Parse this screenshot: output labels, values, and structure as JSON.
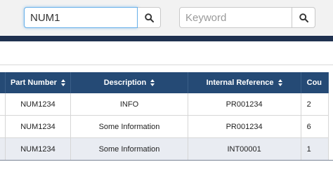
{
  "search": {
    "primary_value": "NUM1",
    "keyword_placeholder": "Keyword"
  },
  "table": {
    "headers": [
      "Part Number",
      "Description",
      "Internal Reference",
      "Cou"
    ],
    "rows": [
      [
        "NUM1234",
        "INFO",
        "PR001234",
        "2"
      ],
      [
        "NUM1234",
        "Some Information",
        "PR001234",
        "6"
      ],
      [
        "NUM1234",
        "Some Information",
        "INT00001",
        "1"
      ]
    ]
  },
  "icons": {
    "search": "search-icon",
    "sort": "sort-icon"
  },
  "colors": {
    "header_bg": "#254a75",
    "navy_band": "#1f3150",
    "alt_row": "#e9ecf2",
    "focus_border": "#66afe9"
  }
}
